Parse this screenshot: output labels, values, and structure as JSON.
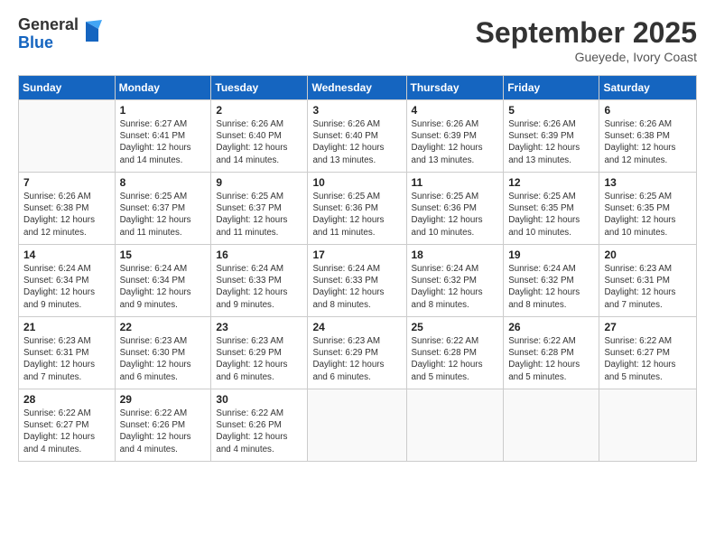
{
  "logo": {
    "general": "General",
    "blue": "Blue"
  },
  "header": {
    "month": "September 2025",
    "location": "Gueyede, Ivory Coast"
  },
  "weekdays": [
    "Sunday",
    "Monday",
    "Tuesday",
    "Wednesday",
    "Thursday",
    "Friday",
    "Saturday"
  ],
  "weeks": [
    [
      {
        "day": "",
        "info": ""
      },
      {
        "day": "1",
        "info": "Sunrise: 6:27 AM\nSunset: 6:41 PM\nDaylight: 12 hours\nand 14 minutes."
      },
      {
        "day": "2",
        "info": "Sunrise: 6:26 AM\nSunset: 6:40 PM\nDaylight: 12 hours\nand 14 minutes."
      },
      {
        "day": "3",
        "info": "Sunrise: 6:26 AM\nSunset: 6:40 PM\nDaylight: 12 hours\nand 13 minutes."
      },
      {
        "day": "4",
        "info": "Sunrise: 6:26 AM\nSunset: 6:39 PM\nDaylight: 12 hours\nand 13 minutes."
      },
      {
        "day": "5",
        "info": "Sunrise: 6:26 AM\nSunset: 6:39 PM\nDaylight: 12 hours\nand 13 minutes."
      },
      {
        "day": "6",
        "info": "Sunrise: 6:26 AM\nSunset: 6:38 PM\nDaylight: 12 hours\nand 12 minutes."
      }
    ],
    [
      {
        "day": "7",
        "info": "Sunrise: 6:26 AM\nSunset: 6:38 PM\nDaylight: 12 hours\nand 12 minutes."
      },
      {
        "day": "8",
        "info": "Sunrise: 6:25 AM\nSunset: 6:37 PM\nDaylight: 12 hours\nand 11 minutes."
      },
      {
        "day": "9",
        "info": "Sunrise: 6:25 AM\nSunset: 6:37 PM\nDaylight: 12 hours\nand 11 minutes."
      },
      {
        "day": "10",
        "info": "Sunrise: 6:25 AM\nSunset: 6:36 PM\nDaylight: 12 hours\nand 11 minutes."
      },
      {
        "day": "11",
        "info": "Sunrise: 6:25 AM\nSunset: 6:36 PM\nDaylight: 12 hours\nand 10 minutes."
      },
      {
        "day": "12",
        "info": "Sunrise: 6:25 AM\nSunset: 6:35 PM\nDaylight: 12 hours\nand 10 minutes."
      },
      {
        "day": "13",
        "info": "Sunrise: 6:25 AM\nSunset: 6:35 PM\nDaylight: 12 hours\nand 10 minutes."
      }
    ],
    [
      {
        "day": "14",
        "info": "Sunrise: 6:24 AM\nSunset: 6:34 PM\nDaylight: 12 hours\nand 9 minutes."
      },
      {
        "day": "15",
        "info": "Sunrise: 6:24 AM\nSunset: 6:34 PM\nDaylight: 12 hours\nand 9 minutes."
      },
      {
        "day": "16",
        "info": "Sunrise: 6:24 AM\nSunset: 6:33 PM\nDaylight: 12 hours\nand 9 minutes."
      },
      {
        "day": "17",
        "info": "Sunrise: 6:24 AM\nSunset: 6:33 PM\nDaylight: 12 hours\nand 8 minutes."
      },
      {
        "day": "18",
        "info": "Sunrise: 6:24 AM\nSunset: 6:32 PM\nDaylight: 12 hours\nand 8 minutes."
      },
      {
        "day": "19",
        "info": "Sunrise: 6:24 AM\nSunset: 6:32 PM\nDaylight: 12 hours\nand 8 minutes."
      },
      {
        "day": "20",
        "info": "Sunrise: 6:23 AM\nSunset: 6:31 PM\nDaylight: 12 hours\nand 7 minutes."
      }
    ],
    [
      {
        "day": "21",
        "info": "Sunrise: 6:23 AM\nSunset: 6:31 PM\nDaylight: 12 hours\nand 7 minutes."
      },
      {
        "day": "22",
        "info": "Sunrise: 6:23 AM\nSunset: 6:30 PM\nDaylight: 12 hours\nand 6 minutes."
      },
      {
        "day": "23",
        "info": "Sunrise: 6:23 AM\nSunset: 6:29 PM\nDaylight: 12 hours\nand 6 minutes."
      },
      {
        "day": "24",
        "info": "Sunrise: 6:23 AM\nSunset: 6:29 PM\nDaylight: 12 hours\nand 6 minutes."
      },
      {
        "day": "25",
        "info": "Sunrise: 6:22 AM\nSunset: 6:28 PM\nDaylight: 12 hours\nand 5 minutes."
      },
      {
        "day": "26",
        "info": "Sunrise: 6:22 AM\nSunset: 6:28 PM\nDaylight: 12 hours\nand 5 minutes."
      },
      {
        "day": "27",
        "info": "Sunrise: 6:22 AM\nSunset: 6:27 PM\nDaylight: 12 hours\nand 5 minutes."
      }
    ],
    [
      {
        "day": "28",
        "info": "Sunrise: 6:22 AM\nSunset: 6:27 PM\nDaylight: 12 hours\nand 4 minutes."
      },
      {
        "day": "29",
        "info": "Sunrise: 6:22 AM\nSunset: 6:26 PM\nDaylight: 12 hours\nand 4 minutes."
      },
      {
        "day": "30",
        "info": "Sunrise: 6:22 AM\nSunset: 6:26 PM\nDaylight: 12 hours\nand 4 minutes."
      },
      {
        "day": "",
        "info": ""
      },
      {
        "day": "",
        "info": ""
      },
      {
        "day": "",
        "info": ""
      },
      {
        "day": "",
        "info": ""
      }
    ]
  ]
}
